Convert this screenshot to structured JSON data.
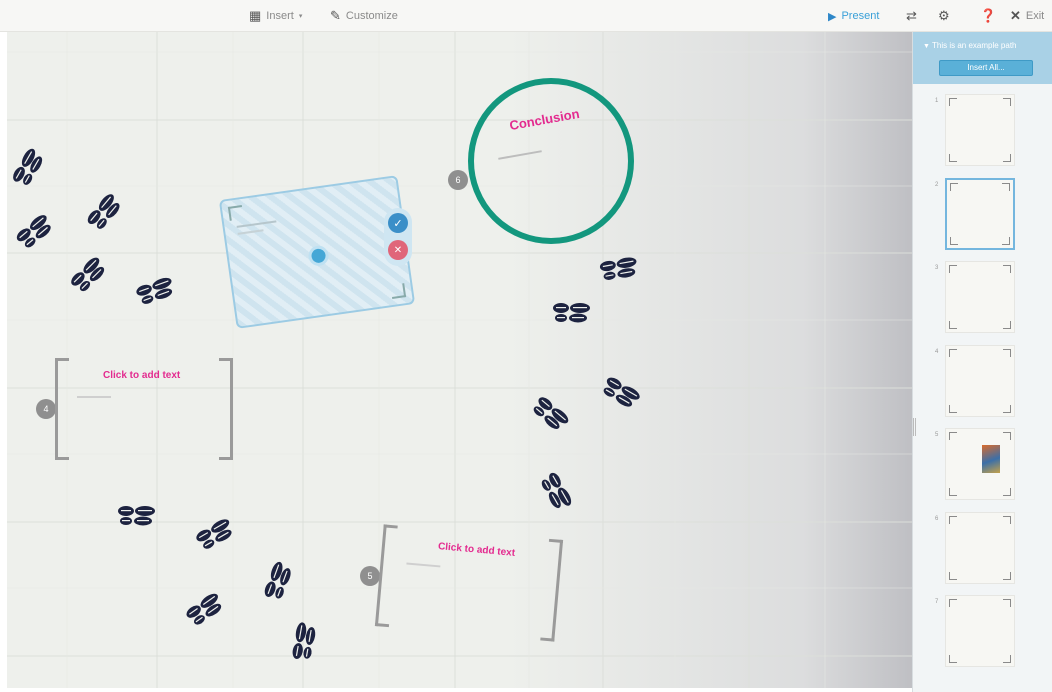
{
  "toolbar": {
    "insert_label": "Insert",
    "customize_label": "Customize",
    "present_label": "Present",
    "exit_label": "Exit",
    "insert_icon": "insert-icon",
    "customize_icon": "pencil-icon"
  },
  "canvas": {
    "conclusion_title": "Conclusion",
    "frames": [
      {
        "number": "4",
        "placeholder": "Click to add text"
      },
      {
        "number": "5",
        "placeholder": "Click to add text"
      },
      {
        "number": "6",
        "title": "Conclusion"
      }
    ]
  },
  "sidebar": {
    "title": "This is an example path",
    "insert_all_label": "Insert All...",
    "thumbnails": [
      {
        "number": "1"
      },
      {
        "number": "2",
        "selected": true
      },
      {
        "number": "3"
      },
      {
        "number": "4"
      },
      {
        "number": "5"
      },
      {
        "number": "6"
      },
      {
        "number": "7"
      }
    ]
  },
  "colors": {
    "accent": "#2e87c8",
    "ring": "#13977e",
    "placeholder_text": "#e32b8f",
    "sidebar_header": "#a9d1e6"
  }
}
